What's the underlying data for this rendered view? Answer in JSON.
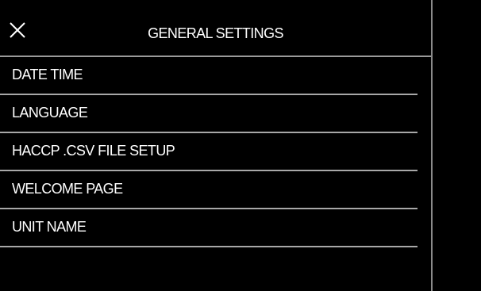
{
  "header": {
    "title": "GENERAL SETTINGS",
    "close_icon": "close-icon"
  },
  "menu": {
    "items": [
      {
        "label": "DATE TIME"
      },
      {
        "label": "LANGUAGE"
      },
      {
        "label": "HACCP .CSV FILE SETUP"
      },
      {
        "label": "WELCOME PAGE"
      },
      {
        "label": "UNIT NAME"
      }
    ]
  },
  "colors": {
    "background": "#000000",
    "text": "#ffffff",
    "divider": "#a8a8a8"
  }
}
